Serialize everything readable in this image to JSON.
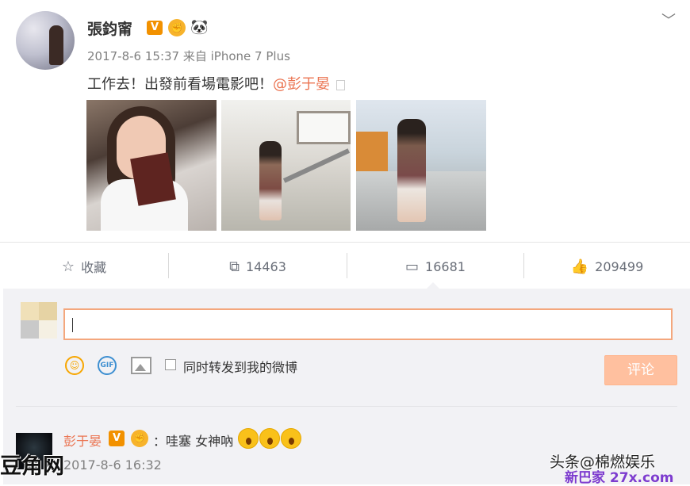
{
  "header": {
    "username": "張鈞甯",
    "verified_badge": "V",
    "badge_emoji_icon": "fist-bump-badge-icon",
    "panda_icon": "🐼",
    "timestamp": "2017-8-6 15:37",
    "source": "来自 iPhone 7 Plus",
    "menu_icon": "chevron-down-icon"
  },
  "post": {
    "text": "工作去！出發前看場電影吧！",
    "mention": "@彭于晏",
    "images": [
      "photo-with-tickets",
      "photo-escalator",
      "photo-mall-walk"
    ]
  },
  "actions": {
    "favorite_label": "收藏",
    "repost_count": "14463",
    "comment_count": "16681",
    "like_count": "209499"
  },
  "composer": {
    "input_value": "",
    "emoji_icon": "☺",
    "gif_label": "GIF",
    "repost_checkbox_label": "同时转发到我的微博",
    "submit_label": "评论"
  },
  "comments": [
    {
      "author": "彭于晏",
      "verified_badge": "V",
      "separator": "：",
      "text": "哇塞 女神吶",
      "time": "2017-8-6 16:32"
    }
  ],
  "watermarks": {
    "left": "豆角网",
    "right_top": "头条@棉燃娱乐",
    "right_bottom": "新巴家 27x.com"
  },
  "colors": {
    "accent": "#eb7350",
    "verified": "#f29100",
    "submit_bg": "#ffc09f"
  }
}
